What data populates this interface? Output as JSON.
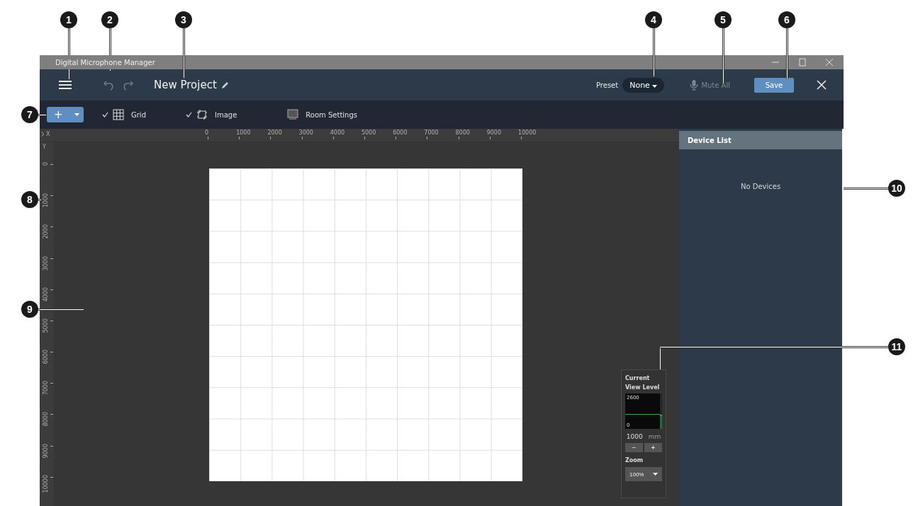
{
  "callouts": [
    "1",
    "2",
    "3",
    "4",
    "5",
    "6",
    "7",
    "8",
    "9",
    "10",
    "11"
  ],
  "window": {
    "title": "Digital Microphone Manager"
  },
  "header": {
    "project_name": "New Project",
    "undo_disabled": true,
    "redo_disabled": true,
    "preset_label": "Preset",
    "preset_value": "None",
    "mute_all": {
      "label": "Mute All",
      "disabled": true
    },
    "save": "Save"
  },
  "toolbar": {
    "add_button": "+",
    "toggles": [
      {
        "label": "Grid",
        "checked": true,
        "kind": "grid"
      },
      {
        "label": "Image",
        "checked": true,
        "kind": "image"
      },
      {
        "label": "Room Settings",
        "checked": false,
        "kind": "room"
      }
    ]
  },
  "rulers": {
    "x_label": "X",
    "y_label": "Y",
    "x_ticks": [
      "0",
      "1000",
      "2000",
      "3000",
      "4000",
      "5000",
      "6000",
      "7000",
      "8000",
      "9000",
      "10000"
    ],
    "y_ticks": [
      "0",
      "1000",
      "2000",
      "3000",
      "4000",
      "5000",
      "6000",
      "7000",
      "8000",
      "9000",
      "10000"
    ]
  },
  "view_level": {
    "title": "Current View Level",
    "max": "2600",
    "min": "0",
    "level": 0.4,
    "value": "1000",
    "unit": "mm",
    "minus": "−",
    "plus": "+",
    "zoom_label": "Zoom",
    "zoom_value": "100%"
  },
  "device_list": {
    "title": "Device List",
    "empty_text": "No Devices"
  }
}
